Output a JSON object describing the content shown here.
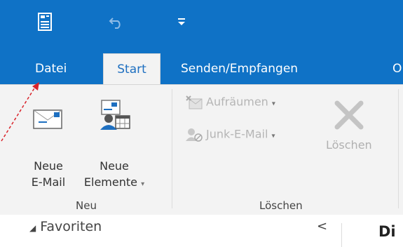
{
  "title_bar": {
    "background": "#0f72c6",
    "quick_access": [
      {
        "icon": "save-icon"
      },
      {
        "icon": "undo-icon"
      },
      {
        "icon": "customize-toolbar-icon"
      }
    ]
  },
  "tabs": [
    {
      "label": "Datei",
      "active": false
    },
    {
      "label": "Start",
      "active": true
    },
    {
      "label": "Senden/Empfangen",
      "active": false
    },
    {
      "label": "O",
      "active": false
    }
  ],
  "ribbon": {
    "groups": [
      {
        "label": "Neu",
        "buttons": [
          {
            "line1": "Neue",
            "line2": "E-Mail",
            "icon": "envelope-icon"
          },
          {
            "line1": "Neue",
            "line2": "Elemente",
            "icon": "new-items-icon",
            "has_dropdown": true
          }
        ]
      },
      {
        "label": "Löschen",
        "buttons": [
          {
            "label": "Aufräumen",
            "icon": "clean-up-icon",
            "has_dropdown": true,
            "enabled": false
          },
          {
            "label": "Junk-E-Mail",
            "icon": "junk-icon",
            "has_dropdown": true,
            "enabled": false
          },
          {
            "label": "Löschen",
            "icon": "delete-x-icon",
            "enabled": false
          }
        ]
      }
    ]
  },
  "folder_pane": {
    "favorites_label": "Favoriten",
    "collapse_glyph": "<"
  },
  "message_list": {
    "heading_partial": "Di"
  },
  "annotation": {
    "callout_color": "#d9232a",
    "points_to": "Datei"
  }
}
